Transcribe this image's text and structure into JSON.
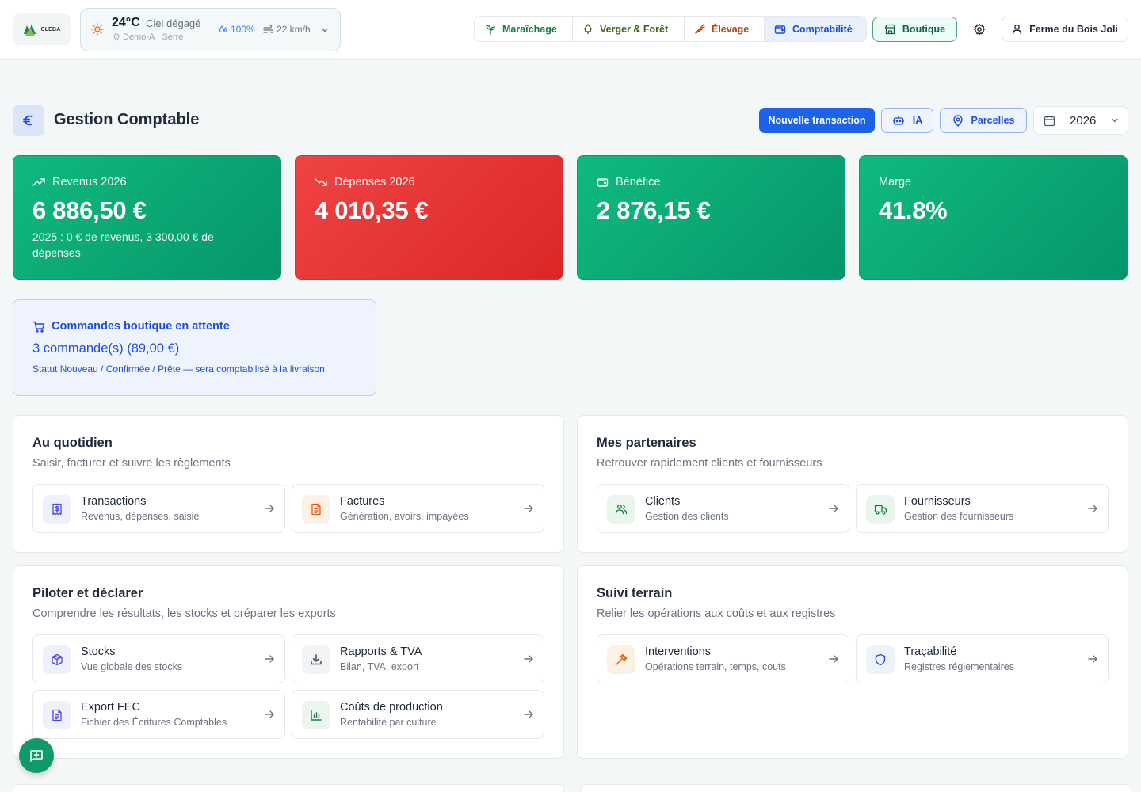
{
  "app": {
    "logo_text": "CLEBA"
  },
  "weather": {
    "temperature": "24°C",
    "description": "Ciel dégagé",
    "location": "Demo-A · Serre",
    "humidity": "100%",
    "wind": "22 km/h"
  },
  "nav": {
    "items": [
      {
        "label": "Maraîchage",
        "icon": "sprout-icon"
      },
      {
        "label": "Verger & Forêt",
        "icon": "tree-icon"
      },
      {
        "label": "Élevage",
        "icon": "carrot-icon"
      },
      {
        "label": "Comptabilité",
        "icon": "wallet-icon",
        "active": true
      }
    ],
    "shop_label": "Boutique",
    "farm_label": "Ferme du Bois Joli"
  },
  "page": {
    "title": "Gestion Comptable",
    "new_transaction_label": "Nouvelle transaction",
    "ia_label": "IA",
    "parcelles_label": "Parcelles",
    "year": "2026"
  },
  "kpis": [
    {
      "label": "Revenus 2026",
      "value": "6 886,50 €",
      "sub": "2025 : 0 € de revenus, 3 300,00 € de dépenses",
      "color": "#10b981"
    },
    {
      "label": "Dépenses 2026",
      "value": "4 010,35 €",
      "sub": "",
      "color": "#ef4444"
    },
    {
      "label": "Bénéfice",
      "value": "2 876,15 €",
      "sub": "",
      "color": "#10b981"
    },
    {
      "label": "Marge",
      "value": "41.8%",
      "sub": "",
      "color": "#10b981"
    }
  ],
  "pending_orders": {
    "title": "Commandes boutique en attente",
    "value": "3 commande(s) (89,00 €)",
    "note": "Statut Nouveau / Confirmée / Prête — sera comptabilisé à la livraison."
  },
  "sections": {
    "daily": {
      "title": "Au quotidien",
      "subtitle": "Saisir, facturer et suivre les règlements",
      "tiles": [
        {
          "title": "Transactions",
          "subtitle": "Revenus, dépenses, saisie"
        },
        {
          "title": "Factures",
          "subtitle": "Génération, avoirs, impayées"
        }
      ]
    },
    "partners": {
      "title": "Mes partenaires",
      "subtitle": "Retrouver rapidement clients et fournisseurs",
      "tiles": [
        {
          "title": "Clients",
          "subtitle": "Gestion des clients"
        },
        {
          "title": "Fournisseurs",
          "subtitle": "Gestion des fournisseurs"
        }
      ]
    },
    "reporting": {
      "title": "Piloter et déclarer",
      "subtitle": "Comprendre les résultats, les stocks et préparer les exports",
      "tiles": [
        {
          "title": "Stocks",
          "subtitle": "Vue globale des stocks"
        },
        {
          "title": "Rapports & TVA",
          "subtitle": "Bilan, TVA, export"
        },
        {
          "title": "Export FEC",
          "subtitle": "Fichier des Écritures Comptables"
        },
        {
          "title": "Coûts de production",
          "subtitle": "Rentabilité par culture"
        }
      ]
    },
    "field": {
      "title": "Suivi terrain",
      "subtitle": "Relier les opérations aux coûts et aux registres",
      "tiles": [
        {
          "title": "Interventions",
          "subtitle": "Opérations terrain, temps, couts"
        },
        {
          "title": "Traçabilité",
          "subtitle": "Registres réglementaires"
        }
      ]
    }
  }
}
